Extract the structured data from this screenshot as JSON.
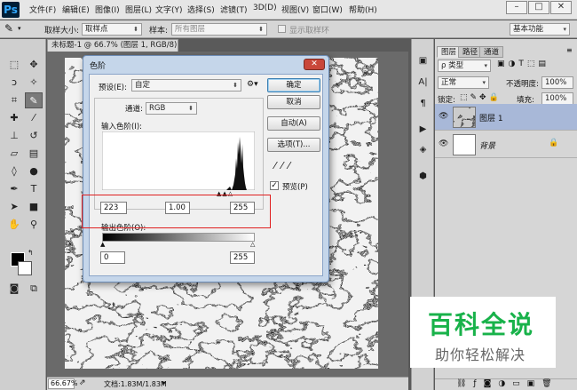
{
  "app": {
    "logo": "Ps"
  },
  "menu": [
    "文件(F)",
    "编辑(E)",
    "图像(I)",
    "图层(L)",
    "文字(Y)",
    "选择(S)",
    "滤镜(T)",
    "3D(D)",
    "视图(V)",
    "窗口(W)",
    "帮助(H)"
  ],
  "window_buttons": {
    "minimize": "–",
    "restore": "□",
    "close": "✕"
  },
  "options_bar": {
    "sample_size_label": "取样大小:",
    "sample_size_value": "取样点",
    "sample_label": "样本:",
    "sample_value": "所有图层",
    "show_ring_label": "显示取样环",
    "workspace": "基本功能"
  },
  "document": {
    "tab_title": "未标题-1 @ 66.7% (图层 1, RGB/8) *",
    "tab_close": "×"
  },
  "status": {
    "zoom": "66.67%",
    "doc_info": "文档:1.83M/1.83M"
  },
  "dialog": {
    "title": "色阶",
    "preset_label": "预设(E):",
    "preset_value": "自定",
    "channel_label": "通道:",
    "channel_value": "RGB",
    "input_levels_label": "输入色阶(I):",
    "input_black": "223",
    "input_gamma": "1.00",
    "input_white": "255",
    "output_levels_label": "输出色阶(O):",
    "output_black": "0",
    "output_white": "255",
    "buttons": {
      "ok": "确定",
      "cancel": "取消",
      "auto": "自动(A)",
      "options": "选项(T)..."
    },
    "preview_label": "预览(P)",
    "preview_checked": true
  },
  "layers_panel": {
    "tabs": [
      "图层",
      "路径",
      "通道"
    ],
    "filter_kind": "ρ 类型",
    "blend_mode": "正常",
    "opacity_label": "不透明度:",
    "opacity_value": "100%",
    "lock_label": "锁定:",
    "fill_label": "填充:",
    "fill_value": "100%",
    "layers": [
      {
        "name": "图层 1",
        "selected": true
      },
      {
        "name": "背景",
        "selected": false,
        "locked": true
      }
    ]
  },
  "watermark": {
    "title": "百科全说",
    "subtitle": "助你轻松解决"
  },
  "colors": {
    "accent_green": "#18b24a",
    "watermark_sub": "#666666",
    "highlight_red": "#e02020",
    "selection": "#a8b8d8"
  }
}
